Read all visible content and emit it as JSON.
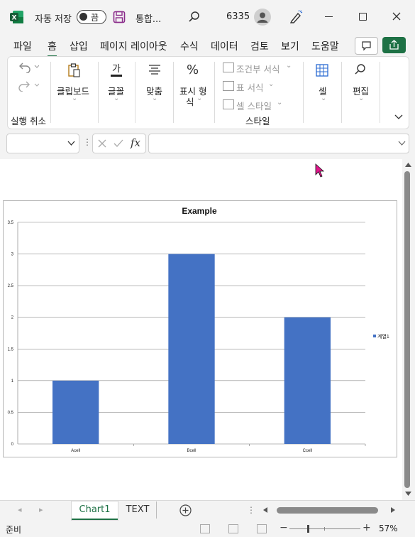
{
  "titlebar": {
    "autosave_label": "자동 저장",
    "toggle_state": "끔",
    "filename": "통합...",
    "user_number": "6335"
  },
  "menu": {
    "tabs": [
      "파일",
      "홈",
      "삽입",
      "페이지 레이아웃",
      "수식",
      "데이터",
      "검토",
      "보기",
      "도움말"
    ],
    "active": "홈"
  },
  "ribbon": {
    "undo_group": "실행 취소",
    "clipboard": "클립보드",
    "font": "글꼴",
    "align": "맞춤",
    "number_line1": "표시 형",
    "number_line2": "식",
    "cond_format": "조건부 서식",
    "table_format": "표 서식",
    "cell_styles": "셀 스타일",
    "styles_group": "스타일",
    "cells": "셀",
    "editing": "편집"
  },
  "formula_bar": {
    "name_box": "",
    "formula": ""
  },
  "chart_data": {
    "type": "bar",
    "title": "Example",
    "categories": [
      "Acell",
      "Bcell",
      "Ccell"
    ],
    "series": [
      {
        "name": "계열1",
        "values": [
          1,
          3,
          2
        ],
        "color": "#4472c4"
      }
    ],
    "ylim": [
      0,
      3.5
    ],
    "yticks": [
      "0",
      "0.5",
      "1",
      "1.5",
      "2",
      "2.5",
      "3",
      "3.5"
    ],
    "grid": true,
    "legend": "right"
  },
  "sheets": {
    "tabs": [
      "Chart1",
      "TEXT"
    ],
    "active": "Chart1"
  },
  "status": {
    "ready": "준비",
    "zoom": "57%"
  },
  "colors": {
    "accent": "#1e7145",
    "bar": "#4472c4",
    "share": "#1e7145"
  }
}
